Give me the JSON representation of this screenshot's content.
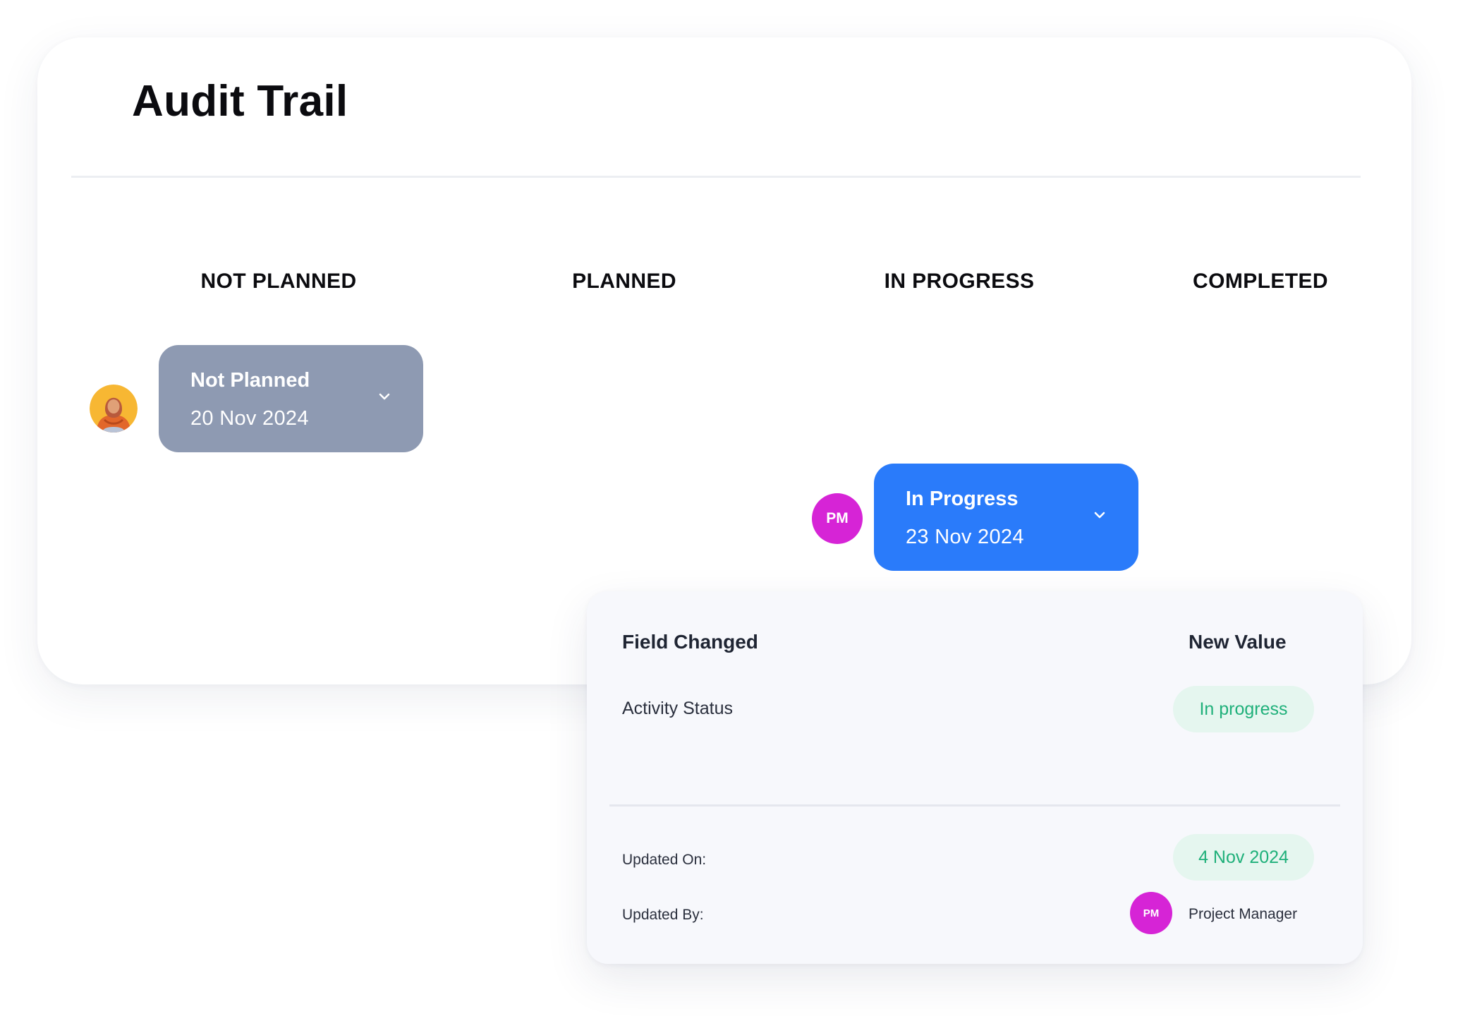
{
  "page": {
    "title": "Audit Trail"
  },
  "columns": [
    {
      "label": "NOT PLANNED"
    },
    {
      "label": "PLANNED"
    },
    {
      "label": "IN PROGRESS"
    },
    {
      "label": "COMPLETED"
    }
  ],
  "entries": [
    {
      "status": "Not Planned",
      "date": "20 Nov 2024",
      "user": {
        "avatar": "user-photo"
      },
      "color": "#8e9ab2"
    },
    {
      "status": "In Progress",
      "date": "23 Nov 2024",
      "user": {
        "initials": "PM"
      },
      "color": "#2a7bfa"
    }
  ],
  "details": {
    "field_changed_header": "Field Changed",
    "new_value_header": "New Value",
    "rows": [
      {
        "field": "Activity Status",
        "value": "In progress"
      }
    ],
    "updated_on_label": "Updated On:",
    "updated_on_value": "4 Nov 2024",
    "updated_by_label": "Updated By:",
    "updated_by": {
      "initials": "PM",
      "name": "Project Manager"
    }
  },
  "colors": {
    "avatar_magenta": "#d624d6",
    "pill_bg": "#e5f6ef",
    "pill_text": "#1fb07a"
  },
  "icons": {
    "expand": "chevron-down-icon"
  }
}
